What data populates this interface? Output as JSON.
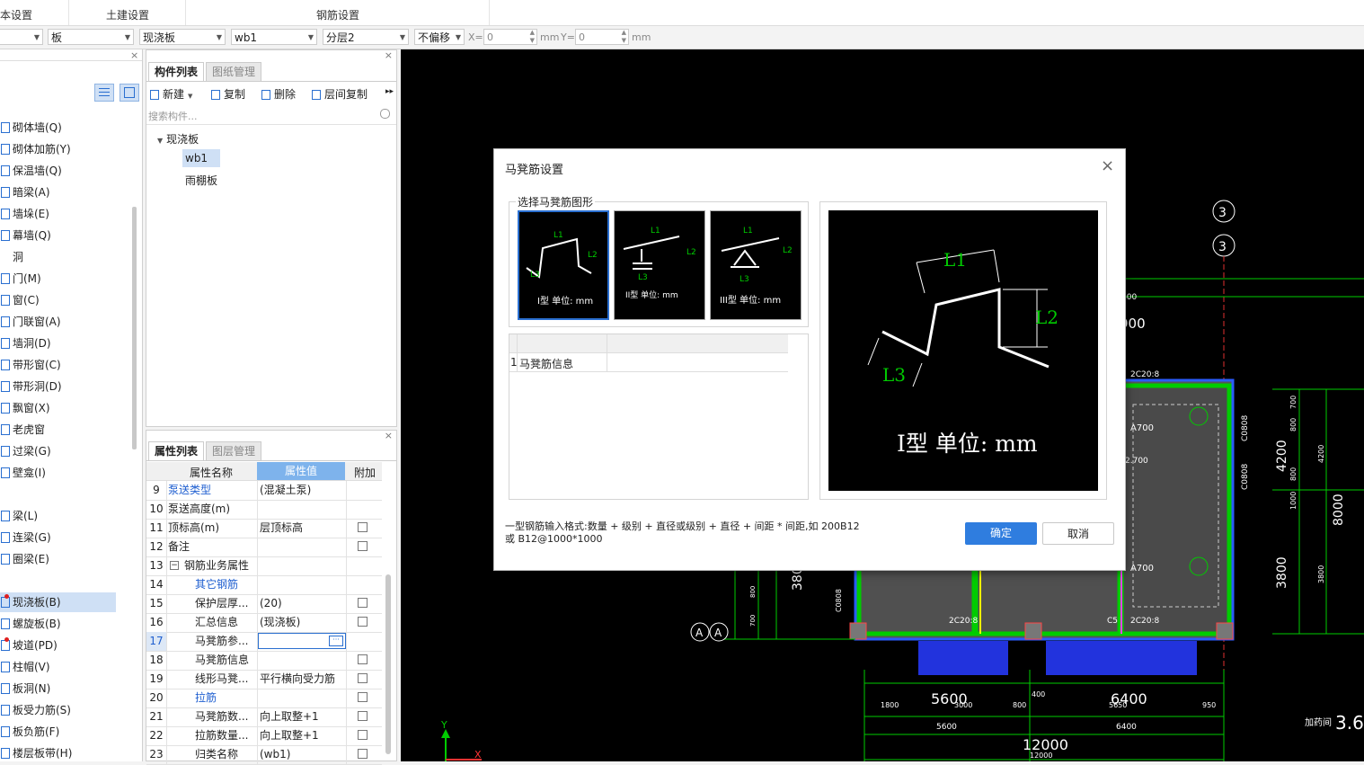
{
  "tabs": [
    "本设置",
    "土建设置",
    "钢筋设置"
  ],
  "filters": {
    "combo1": "",
    "combo2": "板",
    "combo3": "现浇板",
    "combo4": "wb1",
    "combo5": "分层2",
    "combo6": "不偏移",
    "x_label": "X=",
    "x_value": "0",
    "x_unit": "mm",
    "y_label": "Y=",
    "y_value": "0",
    "y_unit": "mm"
  },
  "nav": {
    "items": [
      "砌体墙(Q)",
      "砌体加筋(Y)",
      "保温墙(Q)",
      "暗梁(A)",
      "墙垛(E)",
      "幕墙(Q)",
      "洞",
      "门(M)",
      "窗(C)",
      "门联窗(A)",
      "墙洞(D)",
      "带形窗(C)",
      "带形洞(D)",
      "飘窗(X)",
      "老虎窗",
      "过梁(G)",
      "壁龛(I)",
      "梁(L)",
      "连梁(G)",
      "圈梁(E)",
      "现浇板(B)",
      "螺旋板(B)",
      "坡道(PD)",
      "柱帽(V)",
      "板洞(N)",
      "板受力筋(S)",
      "板负筋(F)",
      "楼层板带(H)"
    ]
  },
  "comp_panel": {
    "tab_active": "构件列表",
    "tab_inactive": "图纸管理",
    "new_label": "新建",
    "copy_label": "复制",
    "delete_label": "删除",
    "floor_copy_label": "层间复制",
    "search_placeholder": "搜索构件...",
    "tree_root": "现浇板",
    "tree_items": [
      "wb1",
      "雨棚板"
    ]
  },
  "prop_panel": {
    "tab_active": "属性列表",
    "tab_inactive": "图层管理",
    "header_name": "属性名称",
    "header_value": "属性值",
    "header_extra": "附加",
    "rows": [
      {
        "num": "9",
        "name": "泵送类型",
        "value": "(混凝土泵)"
      },
      {
        "num": "10",
        "name": "泵送高度(m)",
        "value": ""
      },
      {
        "num": "11",
        "name": "顶标高(m)",
        "value": "层顶标高"
      },
      {
        "num": "12",
        "name": "备注",
        "value": ""
      },
      {
        "num": "13",
        "name": "钢筋业务属性",
        "value": ""
      },
      {
        "num": "14",
        "name": "其它钢筋",
        "value": ""
      },
      {
        "num": "15",
        "name": "保护层厚...",
        "value": "(20)"
      },
      {
        "num": "16",
        "name": "汇总信息",
        "value": "(现浇板)"
      },
      {
        "num": "17",
        "name": "马凳筋参...",
        "value": ""
      },
      {
        "num": "18",
        "name": "马凳筋信息",
        "value": ""
      },
      {
        "num": "19",
        "name": "线形马凳...",
        "value": "平行横向受力筋"
      },
      {
        "num": "20",
        "name": "拉筋",
        "value": ""
      },
      {
        "num": "21",
        "name": "马凳筋数...",
        "value": "向上取整+1"
      },
      {
        "num": "22",
        "name": "拉筋数量...",
        "value": "向上取整+1"
      },
      {
        "num": "23",
        "name": "归类名称",
        "value": "(wb1)"
      }
    ]
  },
  "dialog": {
    "title": "马凳筋设置",
    "group_label": "选择马凳筋图形",
    "shapes": [
      {
        "caption": "I型 单位: mm",
        "l1": "L1",
        "l2": "L2",
        "l3": "L3"
      },
      {
        "caption": "II型 单位: mm",
        "l1": "L1",
        "l2": "L2",
        "l3": "L3"
      },
      {
        "caption": "III型 单位: mm",
        "l1": "L1",
        "l2": "L2",
        "l3": "L3"
      }
    ],
    "table_row_num": "1",
    "table_row_label": "马凳筋信息",
    "preview": {
      "l1": "L1",
      "l2": "L2",
      "l3": "L3",
      "caption": "I型 单位: mm"
    },
    "hint_line1": "一型钢筋输入格式:数量 + 级别 + 直径或级别 + 直径 + 间距 * 间距,如 200B12",
    "hint_line2": "或 B12@1000*1000",
    "ok_label": "确定",
    "cancel_label": "取消"
  },
  "cad": {
    "axis_3": "3",
    "axis_a": "A",
    "dims": [
      "400",
      "2C20:8",
      "A700",
      "2.700",
      "A700",
      "C0808",
      "C0808",
      "4200",
      "700",
      "800",
      "800",
      "1000",
      "4200",
      "8000",
      "3800",
      "3800",
      "800",
      "700",
      "3800",
      "C0808",
      "2C20:8",
      "C5",
      "2C20:8",
      "5600",
      "6400",
      "1800",
      "3000",
      "800",
      "400",
      "5650",
      "950",
      "5600",
      "6400",
      "12000",
      "12000",
      "3.600",
      "加药间"
    ],
    "axis_label_y": "Y",
    "axis_label_x": "X"
  }
}
